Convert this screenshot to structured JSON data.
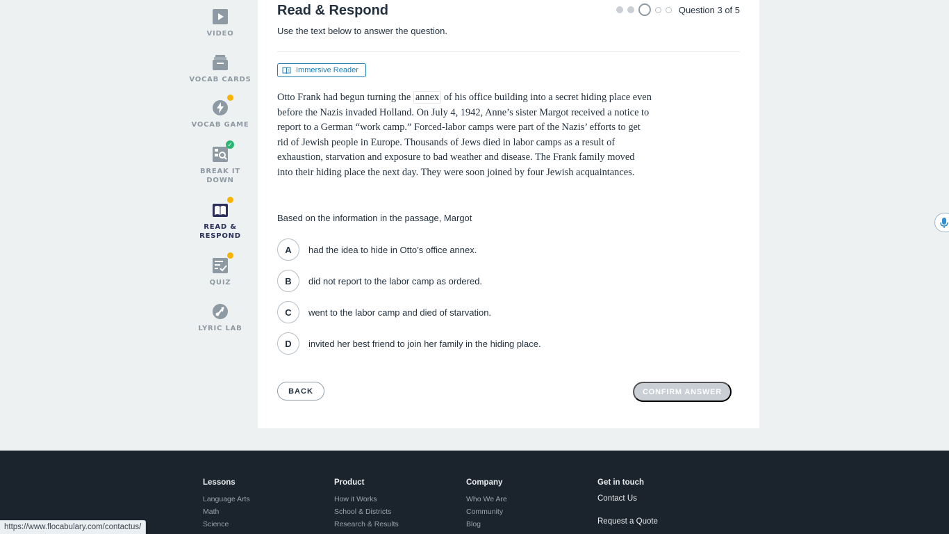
{
  "sidebar": {
    "items": [
      {
        "label": "VIDEO",
        "icon": "video-icon"
      },
      {
        "label": "VOCAB CARDS",
        "icon": "vocab-cards-icon"
      },
      {
        "label": "VOCAB GAME",
        "icon": "lightning-icon",
        "badge": "dot"
      },
      {
        "label1": "BREAK IT",
        "label2": "DOWN",
        "icon": "break-it-down-icon",
        "badge": "check"
      },
      {
        "label1": "READ &",
        "label2": "RESPOND",
        "icon": "book-icon",
        "badge": "dot",
        "active": true
      },
      {
        "label": "QUIZ",
        "icon": "quiz-icon",
        "badge": "dot"
      },
      {
        "label": "LYRIC LAB",
        "icon": "lyric-lab-icon"
      }
    ]
  },
  "main": {
    "title": "Read & Respond",
    "subtitle": "Use the text below to answer the question.",
    "question_counter": "Question 3 of 5",
    "progress": {
      "current": 3,
      "total": 5
    },
    "immersive_reader_label": "Immersive Reader",
    "passage": {
      "before_vocab": "Otto Frank had begun turning the",
      "vocab_word": "annex",
      "after_vocab": "of his office building into a secret hiding place even before the Nazis invaded Holland. On July 4, 1942, Anne’s sister Margot received a notice to report to a German “work camp.” Forced-labor camps were part of the Nazis’ efforts to get rid of Jewish people in Europe. Thousands of Jews died in labor camps as a result of exhaustion, starvation and exposure to bad weather and disease. The Frank family moved into their hiding place the next day. They were soon joined by four Jewish acquaintances."
    },
    "question": "Based on the information in the passage, Margot",
    "options": [
      {
        "letter": "A",
        "text": "had the idea to hide in Otto’s office annex."
      },
      {
        "letter": "B",
        "text": "did not report to the labor camp as ordered."
      },
      {
        "letter": "C",
        "text": "went to the labor camp and died of starvation."
      },
      {
        "letter": "D",
        "text": "invited her best friend to join her family in the hiding place."
      }
    ],
    "back_label": "BACK",
    "confirm_label": "CONFIRM ANSWER"
  },
  "footer": {
    "lessons": {
      "heading": "Lessons",
      "links": [
        "Language Arts",
        "Math",
        "Science"
      ]
    },
    "product": {
      "heading": "Product",
      "links": [
        "How it Works",
        "School & Districts",
        "Research & Results"
      ]
    },
    "company": {
      "heading": "Company",
      "links": [
        "Who We Are",
        "Community",
        "Blog"
      ]
    },
    "contact": {
      "heading": "Get in touch",
      "links": [
        "Contact Us",
        "Request a Quote"
      ]
    }
  },
  "status_bar": {
    "url": "https://www.flocabulary.com/contactus/"
  },
  "colors": {
    "accent_blue": "#1f7fb7",
    "badge_yellow": "#f8b300",
    "badge_green": "#2bb673",
    "footer_bg": "#1b232c",
    "active_nav": "#2a2f5b"
  }
}
